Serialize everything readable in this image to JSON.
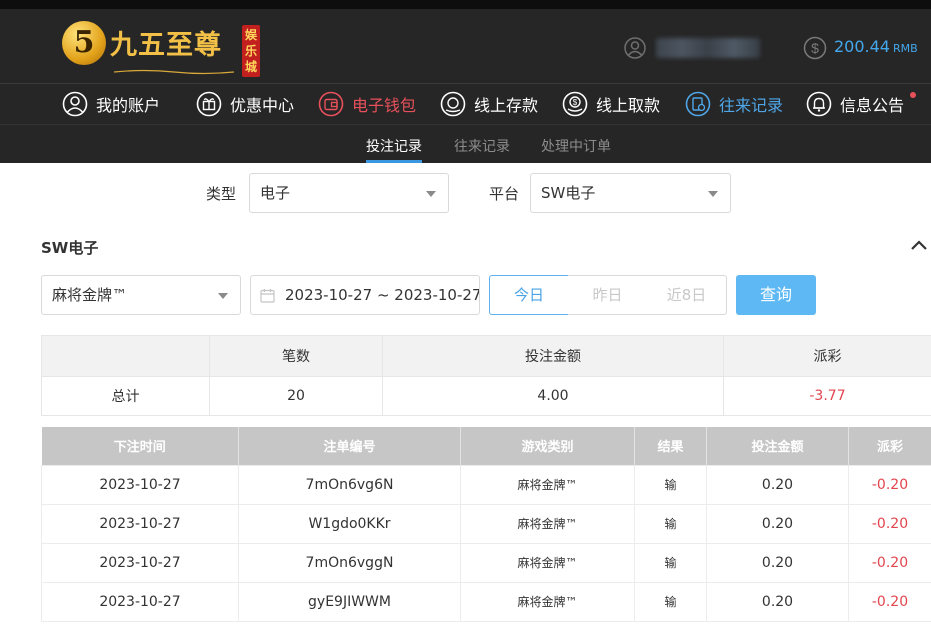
{
  "brand": {
    "logo_numeral": "5",
    "logo_text": "九五至尊",
    "logo_tag": "娱乐城"
  },
  "account": {
    "balance": "200.44",
    "currency": "RMB"
  },
  "nav": {
    "items": [
      {
        "label": "我的账户",
        "icon": "user-circle-icon"
      },
      {
        "label": "优惠中心",
        "icon": "gift-icon"
      },
      {
        "label": "电子钱包",
        "icon": "wallet-icon"
      },
      {
        "label": "线上存款",
        "icon": "deposit-icon"
      },
      {
        "label": "线上取款",
        "icon": "withdraw-icon"
      },
      {
        "label": "往来记录",
        "icon": "records-icon"
      },
      {
        "label": "信息公告",
        "icon": "bell-icon"
      }
    ]
  },
  "subtabs": [
    "投注记录",
    "往来记录",
    "处理中订单"
  ],
  "filters": {
    "type_label": "类型",
    "type_value": "电子",
    "platform_label": "平台",
    "platform_value": "SW电子"
  },
  "section": {
    "title": "SW电子",
    "game_value": "麻将金牌™",
    "date_range": "2023-10-27 ~ 2023-10-27",
    "quick_ranges": [
      "今日",
      "昨日",
      "近8日"
    ],
    "query_label": "查询"
  },
  "summary": {
    "headers": [
      "",
      "笔数",
      "投注金额",
      "派彩"
    ],
    "row": [
      "总计",
      "20",
      "4.00",
      "-3.77"
    ]
  },
  "records": {
    "headers": [
      "下注时间",
      "注单编号",
      "游戏类别",
      "结果",
      "投注金额",
      "派彩"
    ],
    "rows": [
      [
        "2023-10-27",
        "7mOn6vg6N",
        "麻将金牌™",
        "输",
        "0.20",
        "-0.20"
      ],
      [
        "2023-10-27",
        "W1gdo0KKr",
        "麻将金牌™",
        "输",
        "0.20",
        "-0.20"
      ],
      [
        "2023-10-27",
        "7mOn6vggN",
        "麻将金牌™",
        "输",
        "0.20",
        "-0.20"
      ],
      [
        "2023-10-27",
        "gyE9JIWWM",
        "麻将金牌™",
        "输",
        "0.20",
        "-0.20"
      ]
    ]
  },
  "colors": {
    "header_bg": "#262626",
    "accent_blue": "#4ea6e8",
    "accent_red": "#e8505b",
    "negative": "#e2454e"
  }
}
